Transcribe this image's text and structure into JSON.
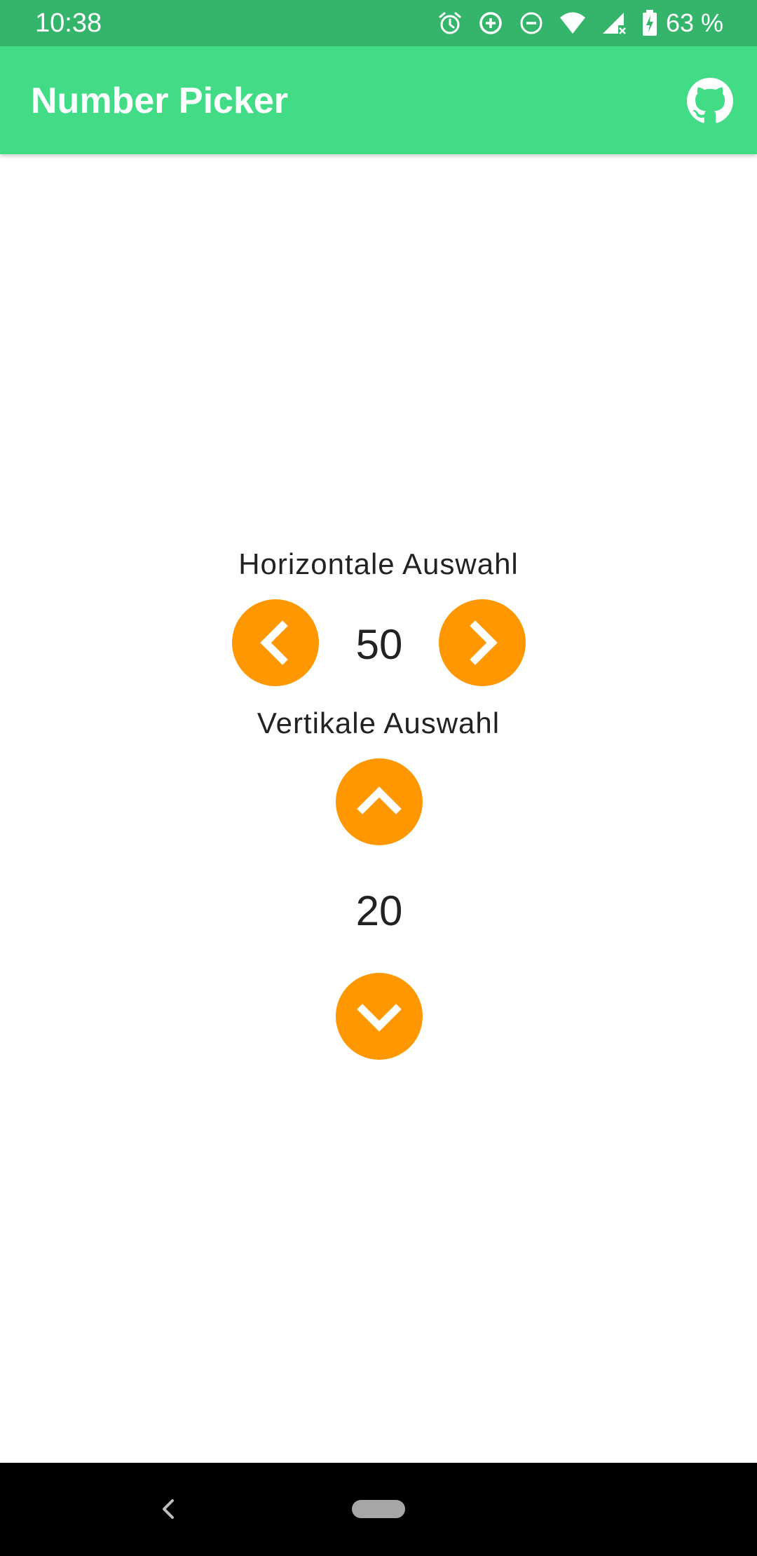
{
  "status_bar": {
    "time": "10:38",
    "battery": "63 %",
    "icons": [
      "alarm-icon",
      "data-saver-icon",
      "do-not-disturb-icon",
      "wifi-icon",
      "signal-icon",
      "battery-charging-icon"
    ]
  },
  "app_bar": {
    "title": "Number Picker",
    "action_icon": "github-icon",
    "color": "#42dc87"
  },
  "horizontal_picker": {
    "label": "Horizontale Auswahl",
    "value": "50",
    "decrement_icon": "chevron-left-icon",
    "increment_icon": "chevron-right-icon"
  },
  "vertical_picker": {
    "label": "Vertikale Auswahl",
    "value": "20",
    "increment_icon": "chevron-up-icon",
    "decrement_icon": "chevron-down-icon"
  },
  "colors": {
    "status_bar": "#35b56c",
    "accent": "#ff9800",
    "text": "#222222"
  },
  "nav_bar": {
    "icons": [
      "back-icon",
      "home-pill-icon"
    ]
  }
}
